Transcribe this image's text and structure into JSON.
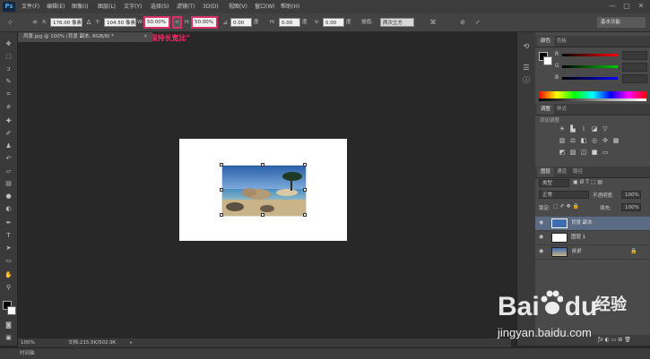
{
  "app": {
    "logo": "Ps"
  },
  "menu": [
    "文件(F)",
    "编辑(E)",
    "图像(I)",
    "图层(L)",
    "文字(Y)",
    "选择(S)",
    "滤镜(T)",
    "3D(D)",
    "视图(V)",
    "窗口(W)",
    "帮助(H)"
  ],
  "window_controls": {
    "minimize": "—",
    "restore": "□",
    "close": "✕"
  },
  "options": {
    "x_label": "X:",
    "x_value": "176.00 像素",
    "y_label": "Y:",
    "y_value": "104.50 像素",
    "w_label": "W:",
    "w_value": "50.00%",
    "h_label": "H:",
    "h_value": "50.00%",
    "angle_value": "0.00",
    "angle_unit": "度",
    "hskew_label": "H:",
    "hskew_value": "0.00",
    "hskew_unit": "度",
    "vskew_label": "V:",
    "vskew_value": "0.00",
    "vskew_unit": "度",
    "interp_label": "插值:",
    "interp_value": "两次立方",
    "workspace": "基本功能"
  },
  "annotation": "“保持长宽比”",
  "document_tab": "风景.jpg @ 100% (背景 副本, RGB/8) *",
  "status": {
    "zoom": "100%",
    "doc_info": "文档:215.5K/502.9K"
  },
  "timeline_label": "时间轴",
  "panels": {
    "color_tabs": [
      "颜色",
      "色板"
    ],
    "color_sliders": [
      {
        "label": "R",
        "value": ""
      },
      {
        "label": "G",
        "value": ""
      },
      {
        "label": "B",
        "value": ""
      }
    ],
    "adjust_tabs": [
      "调整",
      "样式"
    ],
    "adjust_title": "添加调整",
    "layers_tabs": [
      "图层",
      "通道",
      "路径"
    ],
    "kind_filter": "类型",
    "blend_mode": "正常",
    "opacity_label": "不透明度:",
    "opacity_value": "100%",
    "lock_label": "锁定:",
    "fill_label": "填充:",
    "fill_value": "100%",
    "layers": [
      {
        "name": "背景 副本",
        "selected": true
      },
      {
        "name": "图层 1",
        "selected": false
      },
      {
        "name": "背景",
        "selected": false,
        "locked": true
      }
    ]
  },
  "watermark": {
    "brand": "Bai",
    "brand_suffix": "du",
    "cn": "经验",
    "url": "jingyan.baidu.com"
  },
  "colors": {
    "accent_highlight": "#d8306a",
    "ps_blue": "#58a8f0"
  }
}
